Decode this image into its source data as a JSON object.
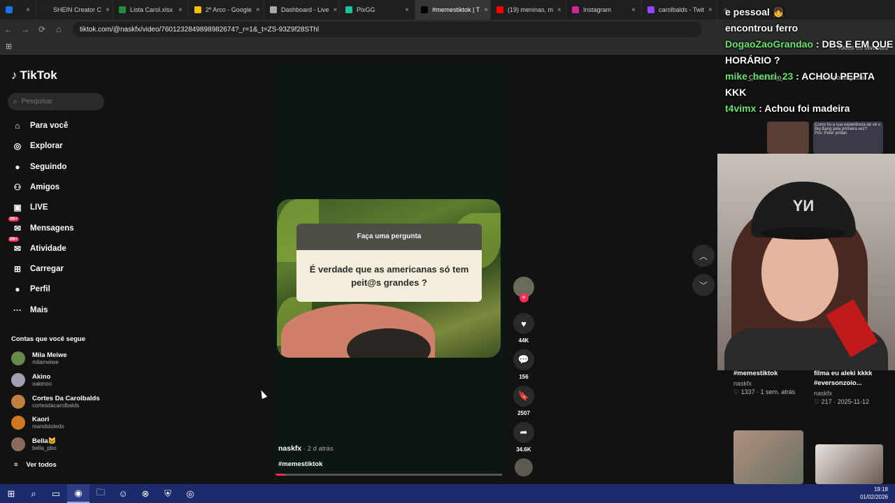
{
  "tabs": [
    {
      "label": "",
      "color": "#1a73e8"
    },
    {
      "label": "SHEIN Creator C",
      "color": "#222222"
    },
    {
      "label": "Lista Carol.xlsx",
      "color": "#1e8e3e"
    },
    {
      "label": "2º Arco - Google",
      "color": "#fbbc04"
    },
    {
      "label": "Dashboard - Live",
      "color": "#aaaaaa"
    },
    {
      "label": "PixGG",
      "color": "#19c39b"
    },
    {
      "label": "#memestiktok | T",
      "color": "#000000",
      "active": true
    },
    {
      "label": "(19) meninas, m",
      "color": "#ff0000"
    },
    {
      "label": "Instagram",
      "color": "#d6249f"
    },
    {
      "label": "carolbalds - Twit",
      "color": "#9146ff"
    }
  ],
  "address": {
    "url": "tiktok.com/@naskfx/video/7601232849898982674?_r=1&_t=ZS-93Z9f28SThl"
  },
  "bookmarks": {
    "all_favorites": "Todos os favoritos"
  },
  "tiktok": {
    "logo": "TikTok",
    "search_placeholder": "Pesquisar",
    "nav": [
      {
        "label": "Para você",
        "icon": "home-icon"
      },
      {
        "label": "Explorar",
        "icon": "compass-icon"
      },
      {
        "label": "Seguindo",
        "icon": "following-avatar-icon"
      },
      {
        "label": "Amigos",
        "icon": "friends-icon"
      },
      {
        "label": "LIVE",
        "icon": "live-icon"
      },
      {
        "label": "Mensagens",
        "icon": "messages-icon",
        "badge": "99+"
      },
      {
        "label": "Atividade",
        "icon": "activity-icon",
        "badge": "99+"
      },
      {
        "label": "Carregar",
        "icon": "upload-icon"
      },
      {
        "label": "Perfil",
        "icon": "profile-icon"
      },
      {
        "label": "Mais",
        "icon": "more-icon"
      }
    ],
    "following_header": "Contas que você segue",
    "following": [
      {
        "name": "Mila Meiwe",
        "handle": "milameiwe",
        "color": "#6a8a4a"
      },
      {
        "name": "Akino",
        "handle": "oakinoo",
        "color": "#a0a0b0"
      },
      {
        "name": "Cortes Da Carolbalds",
        "handle": "cortesdacarolbalds",
        "color": "#c08040"
      },
      {
        "name": "Kaori",
        "handle": "mandstoledo",
        "color": "#d07820"
      },
      {
        "name": "Bella🐱",
        "handle": "bella_pbo",
        "color": "#8a6a5a"
      }
    ],
    "see_all": "Ver todos"
  },
  "video": {
    "question_header": "Faça uma pergunta",
    "question_text": "É verdade que as americanas só tem peit@s grandes ?",
    "author": "naskfx",
    "time": " · 2 d atrás",
    "hashtag": "#memestiktok",
    "progress_fraction": 0.04,
    "likes": "44K",
    "comments": "156",
    "saves": "2507",
    "shares": "34.6K"
  },
  "right_panel": {
    "cards": [
      {
        "title": "#memestiktok",
        "author": "naskfx",
        "likes": "1337",
        "date": "1 sem. atrás"
      },
      {
        "title": "filma eu aleki kkkk #eversonzoio...",
        "author": "naskfx",
        "likes": "217",
        "date": "2025-11-12"
      }
    ],
    "tab_comments": "Comentário",
    "tab_more": "Você pode gostar",
    "thumb_caption": "Como foi a sua experiência de vê o Big Bang pela primeira vez?",
    "thumb_pov": "Pov: Peter jordan"
  },
  "stream": {
    "cap_logo": "YИ",
    "chat": [
      {
        "user": "",
        "text": "e pessoal 👧"
      },
      {
        "user": "",
        "text": "encontrou ferro"
      },
      {
        "user": "DogaoZaoGrandao",
        "text": "DBS E EM QUE HORÁRIO ?"
      },
      {
        "user": "mike_henri_23",
        "text": "ACHOU PEPITA KKK"
      },
      {
        "user": "t4vimx",
        "text": "Achou foi madeira"
      }
    ]
  },
  "taskbar": {
    "time": "19:18",
    "date": "01/02/2026"
  }
}
